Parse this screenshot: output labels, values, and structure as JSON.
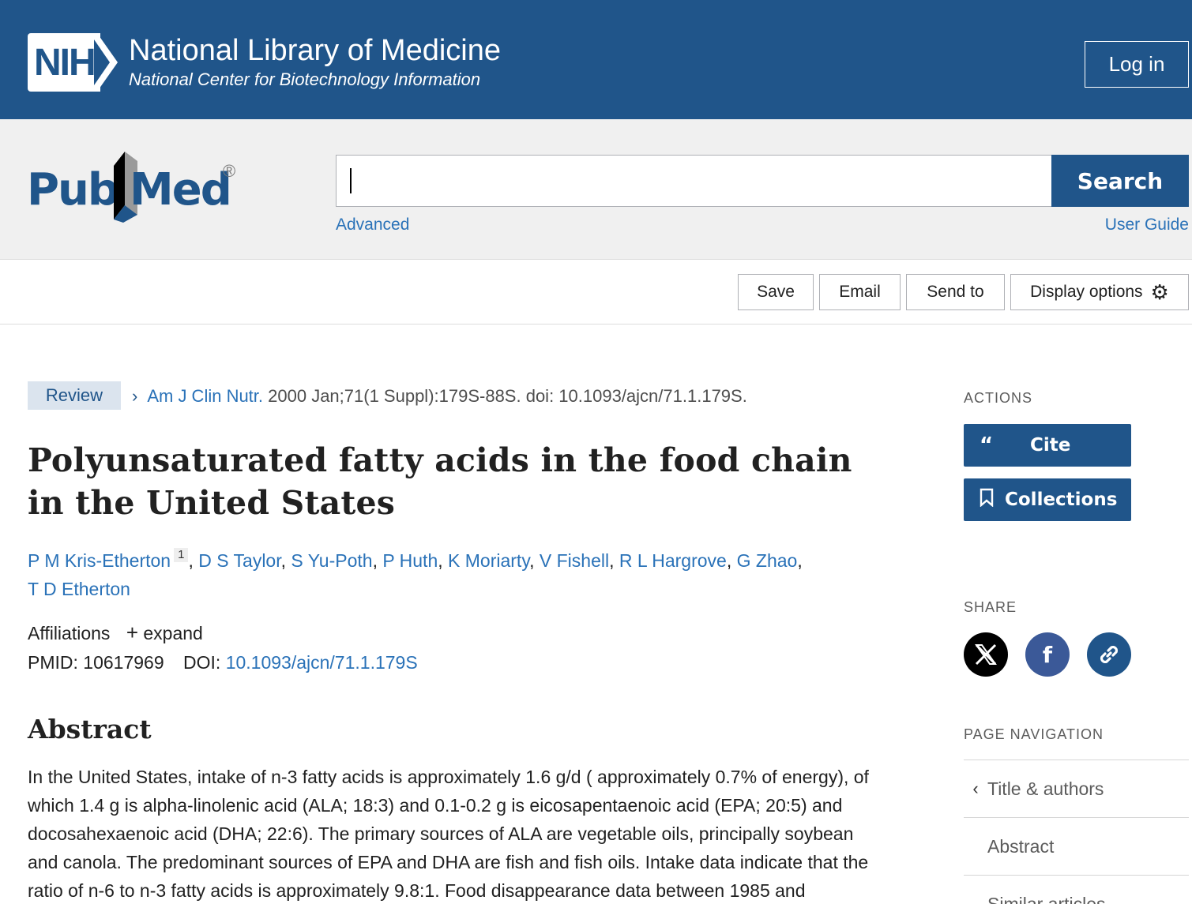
{
  "header": {
    "logo_text": "NIH",
    "org_title": "National Library of Medicine",
    "org_subtitle": "National Center for Biotechnology Information",
    "login_label": "Log in",
    "bg_color": "#20558a"
  },
  "search": {
    "logo_text_left": "Pub",
    "logo_text_right": "Med",
    "logo_registered": "®",
    "query": "",
    "button_label": "Search",
    "advanced_label": "Advanced",
    "guide_label": "User Guide"
  },
  "toolbar": {
    "save_label": "Save",
    "email_label": "Email",
    "send_to_label": "Send to",
    "display_options_label": "Display options",
    "display_options_icon": "gear-icon"
  },
  "article": {
    "type_badge": "Review",
    "journal": "Am J Clin Nutr.",
    "citation_rest": " 2000 Jan;71(1 Suppl):179S-88S. doi: 10.1093/ajcn/71.1.179S.",
    "title": "Polyunsaturated fatty acids in the food chain in the United States",
    "authors": [
      "P M Kris-Etherton",
      "D S Taylor",
      "S Yu-Poth",
      "P Huth",
      "K Moriarty",
      "V Fishell",
      "R L Hargrove",
      "G Zhao",
      "T D Etherton"
    ],
    "first_author_affil_num": "1",
    "affiliations_label": "Affiliations",
    "expand_label": "expand",
    "pmid_label": "PMID:",
    "pmid": "10617969",
    "doi_label": "DOI:",
    "doi": "10.1093/ajcn/71.1.179S",
    "abstract_heading": "Abstract",
    "abstract_text": "In the United States, intake of n-3 fatty acids is approximately 1.6 g/d ( approximately 0.7% of energy), of which 1.4 g is alpha-linolenic acid (ALA; 18:3) and 0.1-0.2 g is eicosapentaenoic acid (EPA; 20:5) and docosahexaenoic acid (DHA; 22:6). The primary sources of ALA are vegetable oils, principally soybean and canola. The predominant sources of EPA and DHA are fish and fish oils. Intake data indicate that the ratio of n-6 to n-3 fatty acids is approximately 9.8:1. Food disappearance data between 1985 and"
  },
  "sidebar": {
    "actions_label": "ACTIONS",
    "cite_label": "Cite",
    "collections_label": "Collections",
    "share_label": "SHARE",
    "share_icons": [
      "x-icon",
      "facebook-icon",
      "link-icon"
    ],
    "page_nav_label": "PAGE NAVIGATION",
    "nav_items": [
      "Title & authors",
      "Abstract",
      "Similar articles"
    ]
  }
}
